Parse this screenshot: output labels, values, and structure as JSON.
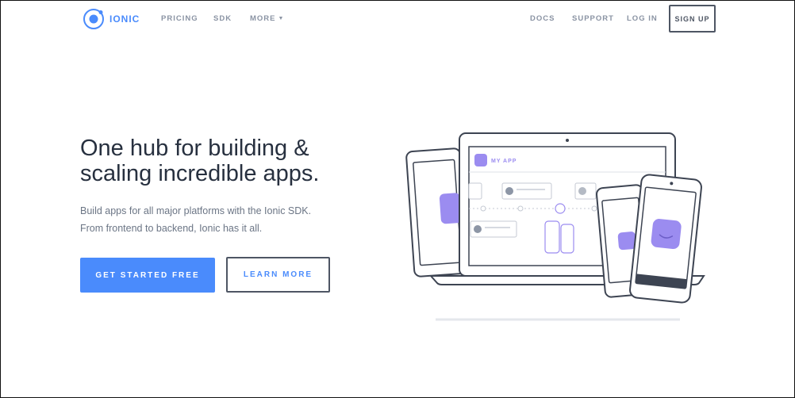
{
  "nav": {
    "logo_text": "IONIC",
    "left_links": [
      "PRICING",
      "SDK",
      "MORE"
    ],
    "right_links": [
      "DOCS",
      "SUPPORT",
      "LOG IN"
    ],
    "signup": "SIGN UP"
  },
  "hero": {
    "headline_line1": "One hub for building &",
    "headline_line2": "scaling incredible apps.",
    "sub_line1": "Build apps for all major platforms with the Ionic SDK.",
    "sub_line2": "From frontend to backend, Ionic has it all.",
    "primary_cta": "GET STARTED FREE",
    "secondary_cta": "LEARN MORE"
  },
  "illustration": {
    "app_title": "MY APP"
  },
  "colors": {
    "accent": "#4a8bfc",
    "purple": "#9b8cf0",
    "outline": "#4e5664"
  }
}
